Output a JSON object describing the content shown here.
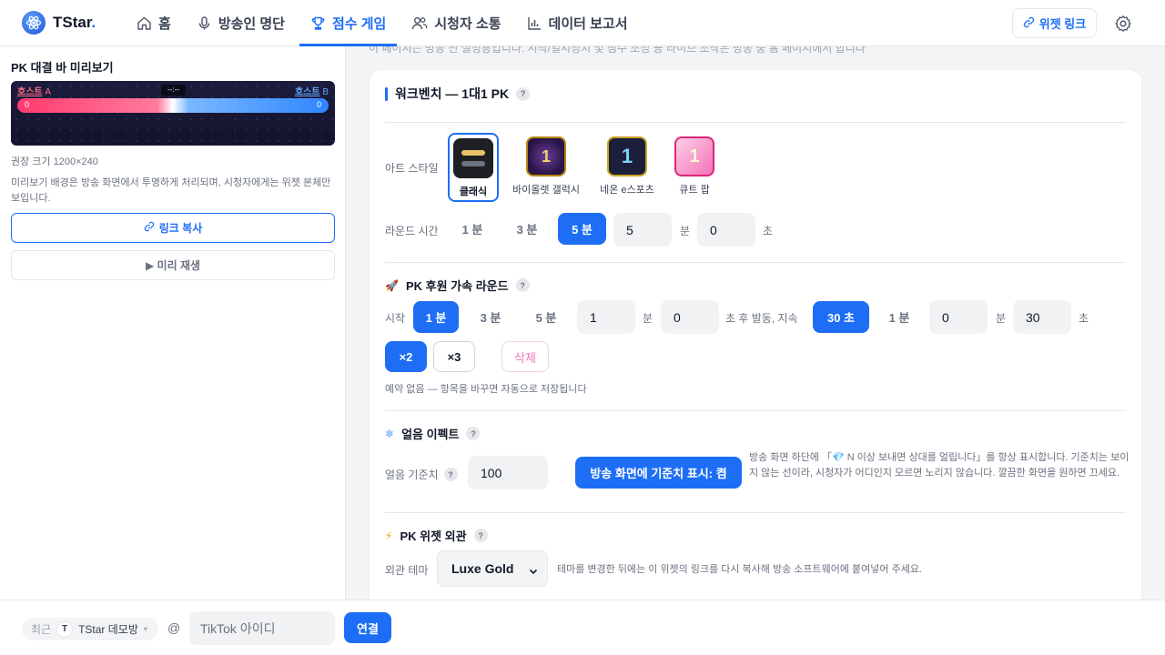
{
  "app": {
    "name": "TStar",
    "name_dot": "."
  },
  "nav": {
    "items": [
      {
        "label": "홈",
        "icon": "home-icon"
      },
      {
        "label": "방송인 명단",
        "icon": "mic-icon"
      },
      {
        "label": "점수 게임",
        "icon": "trophy-icon",
        "active": true
      },
      {
        "label": "시청자 소통",
        "icon": "users-icon"
      },
      {
        "label": "데이터 보고서",
        "icon": "chart-icon"
      }
    ],
    "widget_link_label": "위젯 링크"
  },
  "preview": {
    "title": "PK 대결 바 미리보기",
    "host_a_label": "호스트",
    "host_a_tag": "A",
    "host_b_label": "호스트",
    "host_b_tag": "B",
    "timer": "--:--",
    "score_a": "0",
    "score_b": "0",
    "recommended_size": "권장 크기 1200×240",
    "description": "미리보기 배경은 방송 화면에서 투명하게 처리되며, 시청자에게는 위젯 본체만 보입니다.",
    "copy_link_label": "링크 복사",
    "preview_play_label": "▶ 미리 재생"
  },
  "top_note": "이 페이지는 방송 전 설정용입니다. 시작/일시정지 및 점수 조정 등 라이브 조작은 방송 중 홈 페이지에서 합니다",
  "workbench": {
    "title": "워크벤치 — 1대1 PK",
    "help": "?",
    "art_style_label": "아트 스타일",
    "art_styles": [
      {
        "name": "클래식",
        "selected": true
      },
      {
        "name": "바이올렛 갤럭시",
        "selected": false
      },
      {
        "name": "네온 e스포츠",
        "selected": false
      },
      {
        "name": "큐트 팝",
        "selected": false
      }
    ],
    "round_time_label": "라운드 시간",
    "round_options": [
      "1 분",
      "3 분",
      "5 분"
    ],
    "round_selected": "5 분",
    "round_minutes": "5",
    "round_seconds": "0",
    "unit_min": "분",
    "unit_sec": "초"
  },
  "boost": {
    "title": "PK 후원 가속 라운드",
    "emoji": "🚀",
    "help": "?",
    "start_label": "시작",
    "start_options": [
      "1 분",
      "3 분",
      "5 분"
    ],
    "start_selected": "1 분",
    "start_minutes": "1",
    "start_seconds": "0",
    "after_text": "초 후 발동, 지속",
    "duration_options": [
      "30 초",
      "1 분"
    ],
    "duration_selected": "30 초",
    "duration_minutes": "0",
    "duration_seconds": "30",
    "multipliers": [
      "×2",
      "×3"
    ],
    "multiplier_selected": "×2",
    "delete_label": "삭제",
    "note": "예약 없음 — 항목을 바꾸면 자동으로 저장됩니다"
  },
  "ice": {
    "title": "얼음 이펙트",
    "emoji": "❄",
    "help": "?",
    "threshold_label": "얼음 기준치",
    "threshold_value": "100",
    "toggle_label": "방송 화면에 기준치 표시: 켬",
    "note": "방송 화면 하단에 「💎 N 이상 보내면 상대를 얼립니다」를 항상 표시합니다. 기준치는 보이지 않는 선이라, 시청자가 어디인지 모르면 노리지 않습니다. 깔끔한 화면을 원하면 끄세요."
  },
  "appearance": {
    "title": "PK 위젯 외관",
    "emoji": "⚡",
    "help": "?",
    "theme_label": "외관 테마",
    "theme_value": "Luxe Gold",
    "note": "테마를 변경한 뒤에는 이 위젯의 링크를 다시 복사해 방송 소프트웨어에 붙여넣어 주세요."
  },
  "bottom": {
    "recent_label": "최근",
    "avatar_letter": "T",
    "recent_room": "TStar 데모방",
    "at_symbol": "@",
    "tiktok_placeholder": "TikTok 아이디",
    "connect_label": "연결"
  },
  "colors": {
    "accent": "#1d6ef5",
    "host_a": "#ff3b6f",
    "host_b": "#2f86ff"
  }
}
